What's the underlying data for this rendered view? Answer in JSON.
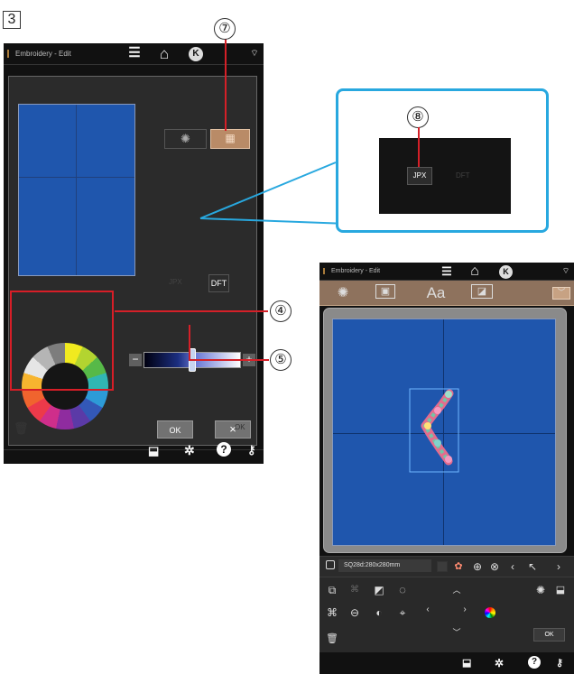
{
  "step_number": "3",
  "callouts": {
    "seven": "⑦",
    "eight": "⑧",
    "four": "④",
    "five": "⑤"
  },
  "left_device": {
    "title": "Embroidery - Edit",
    "ok_label": "OK",
    "cancel_label": "×",
    "jpx_faded": "JPX",
    "dft": "DFT",
    "ok_disabled": "OK"
  },
  "zoom": {
    "jpx": "JPX",
    "dft": "DFT"
  },
  "right_device": {
    "title": "Embroidery - Edit",
    "font_label": "Aa",
    "hoop": "SQ28d:280x280mm",
    "ok_label": "OK"
  }
}
